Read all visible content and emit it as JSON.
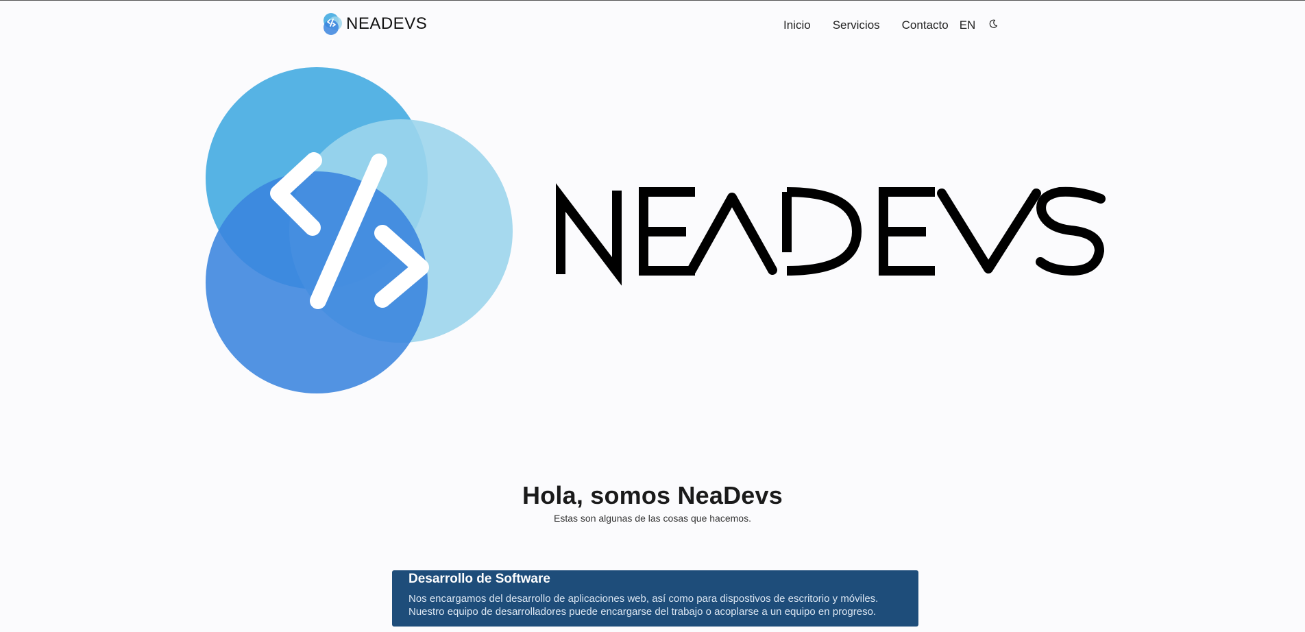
{
  "brand": {
    "name": "NEADEVS",
    "logo_icon": "code-brackets-icon"
  },
  "nav": {
    "inicio": "Inicio",
    "servicios": "Servicios",
    "contacto": "Contacto",
    "language": "EN",
    "theme_icon": "moon-icon"
  },
  "hero": {
    "wordmark": "NEADEVS",
    "logo_icon": "code-brackets-icon"
  },
  "intro": {
    "title": "Hola, somos NeaDevs",
    "subtitle": "Estas son algunas de las cosas que hacemos."
  },
  "services": [
    {
      "title": "Desarrollo de Software",
      "line1": "Nos encargamos del desarrollo de aplicaciones web, así como para dispostivos de escritorio y móviles.",
      "line2": "Nuestro equipo de desarrolladores puede encargarse del trabajo o acoplarse a un equipo en progreso."
    }
  ],
  "colors": {
    "circle_top": "#56b3e4",
    "circle_right": "#9cd5ec",
    "circle_bottom": "#3a84de",
    "card_bg": "#1e4d7a",
    "page_bg": "#fbfbfd"
  }
}
